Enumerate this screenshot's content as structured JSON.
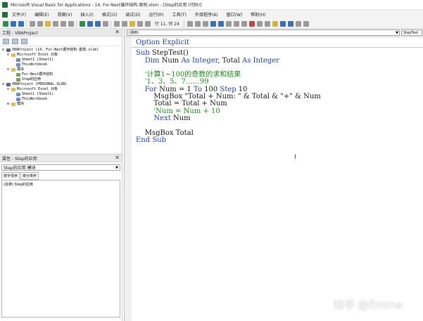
{
  "window": {
    "title": "Microsoft Visual Basic for Applications - 14. For-Next循环结构-案例.xlsm - [Step的应用 (代码)]"
  },
  "menu": {
    "items": [
      "文件(F)",
      "编辑(E)",
      "视图(V)",
      "插入(I)",
      "格式(O)",
      "调试(D)",
      "运行(R)",
      "工具(T)",
      "外接程序(A)",
      "窗口(W)",
      "帮助(H)"
    ]
  },
  "toolbar": {
    "cursor_position": "行 11, 列 24"
  },
  "project_panel": {
    "title": "工程 - VBAProject",
    "tree": [
      {
        "indent": 0,
        "twist": "⊟",
        "icon": "proj",
        "label": "VBAProject (14. For-Next循环结构-案例.xlsm)"
      },
      {
        "indent": 1,
        "twist": "⊟",
        "icon": "folder",
        "label": "Microsoft Excel 对象"
      },
      {
        "indent": 2,
        "twist": "",
        "icon": "sheet",
        "label": "Sheet1 (Sheet1)"
      },
      {
        "indent": 2,
        "twist": "",
        "icon": "sheet",
        "label": "ThisWorkbook"
      },
      {
        "indent": 1,
        "twist": "⊟",
        "icon": "folder",
        "label": "模块"
      },
      {
        "indent": 2,
        "twist": "",
        "icon": "module",
        "label": "For-Next循环结构"
      },
      {
        "indent": 2,
        "twist": "",
        "icon": "module",
        "label": "Step的应用"
      },
      {
        "indent": 0,
        "twist": "⊟",
        "icon": "proj",
        "label": "VBAProject (PERSONAL.XLSB)"
      },
      {
        "indent": 1,
        "twist": "⊟",
        "icon": "folder",
        "label": "Microsoft Excel 对象"
      },
      {
        "indent": 2,
        "twist": "",
        "icon": "sheet",
        "label": "Sheet1 (Sheet1)"
      },
      {
        "indent": 2,
        "twist": "",
        "icon": "sheet",
        "label": "ThisWorkbook"
      },
      {
        "indent": 1,
        "twist": "⊞",
        "icon": "folder",
        "label": "模块"
      }
    ]
  },
  "properties_panel": {
    "title": "属性 - Step的应用",
    "object_name": "Step的应用",
    "object_type": "模块",
    "tabs": [
      "按字母序",
      "按分类序"
    ],
    "rows": [
      "(名称) Step的应用"
    ]
  },
  "code_window": {
    "object_select": "(通用)",
    "procedure_select": "StepTest",
    "lines": [
      [
        {
          "c": "kw",
          "t": "Option Explicit"
        }
      ],
      "SEP",
      [
        {
          "c": "kw",
          "t": "Sub "
        },
        {
          "c": "plain",
          "t": "StepTest()"
        }
      ],
      [
        {
          "c": "kw",
          "t": "    Dim "
        },
        {
          "c": "plain",
          "t": "Num "
        },
        {
          "c": "kw",
          "t": "As Integer"
        },
        {
          "c": "plain",
          "t": ", Total "
        },
        {
          "c": "kw",
          "t": "As Integer"
        }
      ],
      [
        {
          "c": "plain",
          "t": ""
        }
      ],
      [
        {
          "c": "cm",
          "t": "    '计算1~100的奇数的求和结果"
        }
      ],
      [
        {
          "c": "cm",
          "t": "    '1、3、5、7……99"
        }
      ],
      [
        {
          "c": "kw",
          "t": "    For "
        },
        {
          "c": "plain",
          "t": "Num = 1 "
        },
        {
          "c": "kw",
          "t": "To "
        },
        {
          "c": "plain",
          "t": "100 "
        },
        {
          "c": "kw",
          "t": "Step "
        },
        {
          "c": "plain",
          "t": "10"
        }
      ],
      [
        {
          "c": "plain",
          "t": "        MsgBox \"Total + Num: \" & Total & \"+\" & Num"
        }
      ],
      [
        {
          "c": "plain",
          "t": "        Total = Total + Num"
        }
      ],
      [
        {
          "c": "cm",
          "t": "        'Num = Num + 10"
        }
      ],
      [
        {
          "c": "kw",
          "t": "        Next "
        },
        {
          "c": "plain",
          "t": "Num"
        }
      ],
      [
        {
          "c": "plain",
          "t": ""
        }
      ],
      [
        {
          "c": "plain",
          "t": "    MsgBox Total"
        }
      ],
      [
        {
          "c": "kw",
          "t": "End Sub"
        }
      ]
    ]
  },
  "watermark": "知乎 @Emma",
  "colors": {
    "keyword": "#1f3fae",
    "comment": "#1a8a1a",
    "text": "#141414"
  }
}
